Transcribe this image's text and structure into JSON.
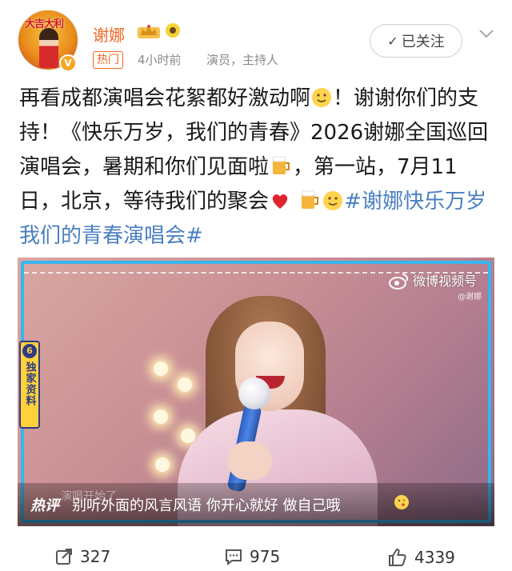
{
  "post": {
    "author": {
      "name": "谢娜",
      "avatar_text": "大吉大利",
      "badge": "热门",
      "time": "4小时前",
      "role": "演员，主持人"
    },
    "follow_button": "已关注",
    "text_main": "再看成都演唱会花絮都好激动啊",
    "text_part2": "！谢谢你们的支持！《快乐万岁，我们的青春》2026谢娜全国巡回演唱会，暑期和你们见面啦",
    "text_part3": "，第一站，7月11日，北京，等待我们的聚会",
    "hashtag": "#谢娜快乐万岁我们的青春演唱会#",
    "icons": [
      "crown-badge-icon",
      "sunflower-badge-icon",
      "smile-emoji-icon",
      "beer-emoji-icon",
      "red-heart-emoji-icon"
    ]
  },
  "media": {
    "watermark_title": "微博视频号",
    "watermark_sub": "@谢娜",
    "side_badge_number": "6",
    "side_badge_text": "独家资料",
    "comment_ghost": "演唱开始了",
    "comment_label": "热评",
    "comment_text": "别听外面的风言风语 你开心就好 做自己哦",
    "colors": {
      "frame": "#39b5ee",
      "badge": "#ffd23b"
    }
  },
  "actions": {
    "share_count": "327",
    "comment_count": "975",
    "like_count": "4339"
  },
  "colors": {
    "accent": "#f26622",
    "hashtag": "#4a7fc1"
  }
}
